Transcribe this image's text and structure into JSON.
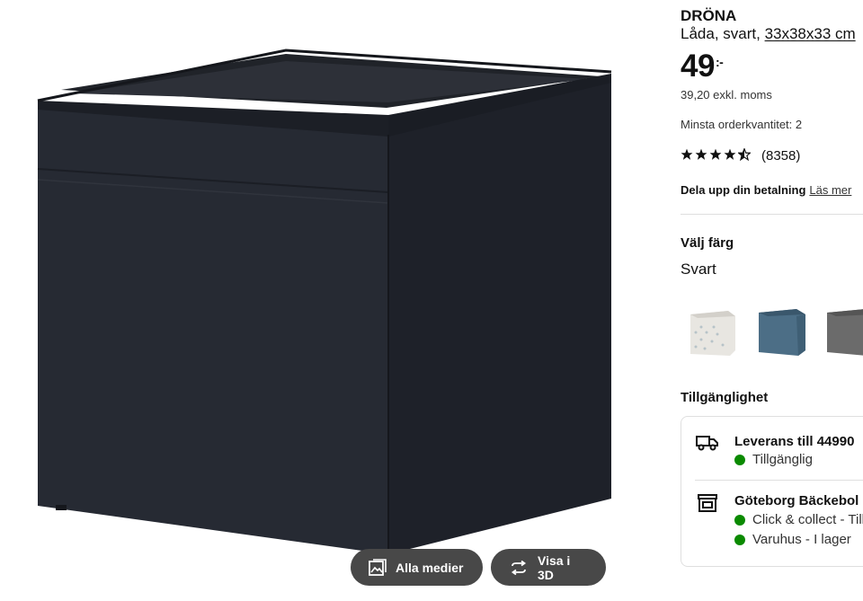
{
  "product": {
    "name": "DRÖNA",
    "desc_prefix": "Låda, svart, ",
    "size": "33x38x33 cm",
    "price": "49",
    "price_suffix": ":-",
    "excl_vat": "39,20 exkl. moms",
    "min_order": "Minsta orderkvantitet: 2",
    "rating_count": "(8358)",
    "rating_value": 4.5,
    "rating_max": 5,
    "pay_text": "Dela upp din betalning",
    "pay_link": "Läs mer"
  },
  "color": {
    "heading": "Välj färg",
    "selected": "Svart",
    "swatches": [
      {
        "name": "white-patterned",
        "color": "#e9e7e2"
      },
      {
        "name": "blue",
        "color": "#4c6e86"
      },
      {
        "name": "grey",
        "color": "#6b6b6b"
      }
    ]
  },
  "availability": {
    "heading": "Tillgänglighet",
    "delivery_title": "Leverans till 44990",
    "delivery_status": "Tillgänglig",
    "store_title": "Göteborg Bäckebol",
    "store_status_1": "Click & collect - Tillgänglig",
    "store_status_2": "Varuhus - I lager",
    "status_color": "#0a8a00"
  },
  "media": {
    "all_media_label": "Alla medier",
    "view_3d_label": "Visa i 3D",
    "box_color": "#23272f"
  }
}
